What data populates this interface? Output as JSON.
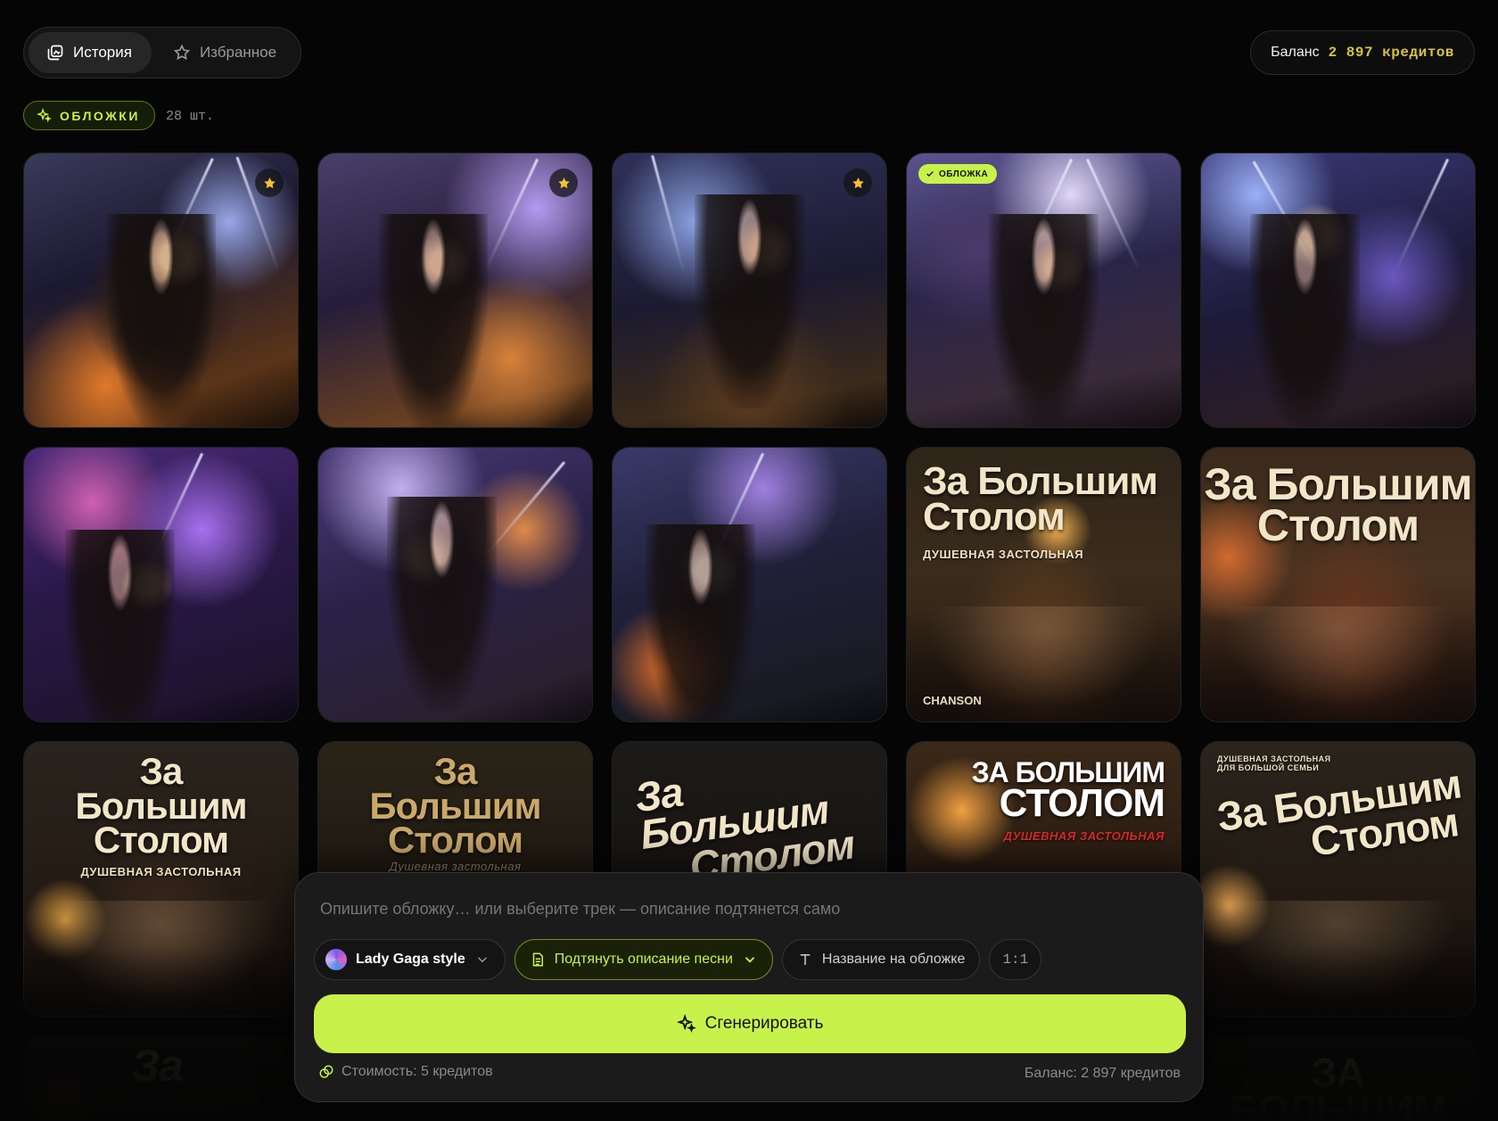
{
  "tabs": [
    {
      "label": "История",
      "icon": "image-history-icon",
      "active": true
    },
    {
      "label": "Избранное",
      "icon": "star-outline-icon",
      "active": false
    }
  ],
  "balance": {
    "label": "Баланс",
    "amount": "2 897 кредитов"
  },
  "section": {
    "label": "ОБЛОЖКИ",
    "count": "28 шт."
  },
  "badges": {
    "cover": "ОБЛОЖКА"
  },
  "gallery": [
    {
      "favorite": true
    },
    {
      "favorite": true
    },
    {
      "favorite": true
    },
    {
      "is_cover": true
    },
    {
      "favorite": false
    },
    {},
    {},
    {},
    {
      "title_line1": "За Большим",
      "title_line2": "Столом",
      "subtitle": "ДУШЕВНАЯ ЗАСТОЛЬНАЯ",
      "brand": "CHANSON"
    },
    {
      "title_line1": "За Большим",
      "title_line2": "Столом"
    },
    {
      "title_line1": "За",
      "title_line2": "Большим",
      "title_line3": "Столом",
      "subtitle": "ДУШЕВНАЯ ЗАСТОЛЬНАЯ"
    },
    {
      "title_line1": "За",
      "title_line2": "Большим",
      "title_line3": "Столом",
      "subtitle": "Душевная застольная"
    },
    {
      "title_line1": "За Большим",
      "title_line2": "Столом"
    },
    {
      "title_line1": "ЗА БОЛЬШИМ",
      "title_line2": "СТОЛОМ",
      "subtitle": "ДУШЕВНАЯ ЗАСТОЛЬНАЯ"
    },
    {
      "kicker_line1": "ДУШЕВНАЯ ЗАСТОЛЬНАЯ",
      "kicker_line2": "ДЛЯ БОЛЬШОЙ СЕМЬИ",
      "title_line1": "За Большим",
      "title_line2": "Столом"
    },
    {
      "title_line1": "За"
    },
    {
      "title_line1": "ЗА БОЛЬШИМ"
    }
  ],
  "composer": {
    "placeholder": "Опишите обложку… или выберите трек — описание подтянется само",
    "style_chip": "Lady Gaga style",
    "lyrics_chip": "Подтянуть описание песни",
    "title_chip": "Название на обложке",
    "ratio_chip": "1:1",
    "generate_label": "Сгенерировать",
    "cost_label": "Стоимость: 5 кредитов",
    "balance_label": "Баланс: 2 897 кредитов"
  },
  "colors": {
    "accent": "#c8f24a",
    "balance_amount": "#d4c24a",
    "background": "#050505",
    "panel": "#1b1b1b"
  }
}
